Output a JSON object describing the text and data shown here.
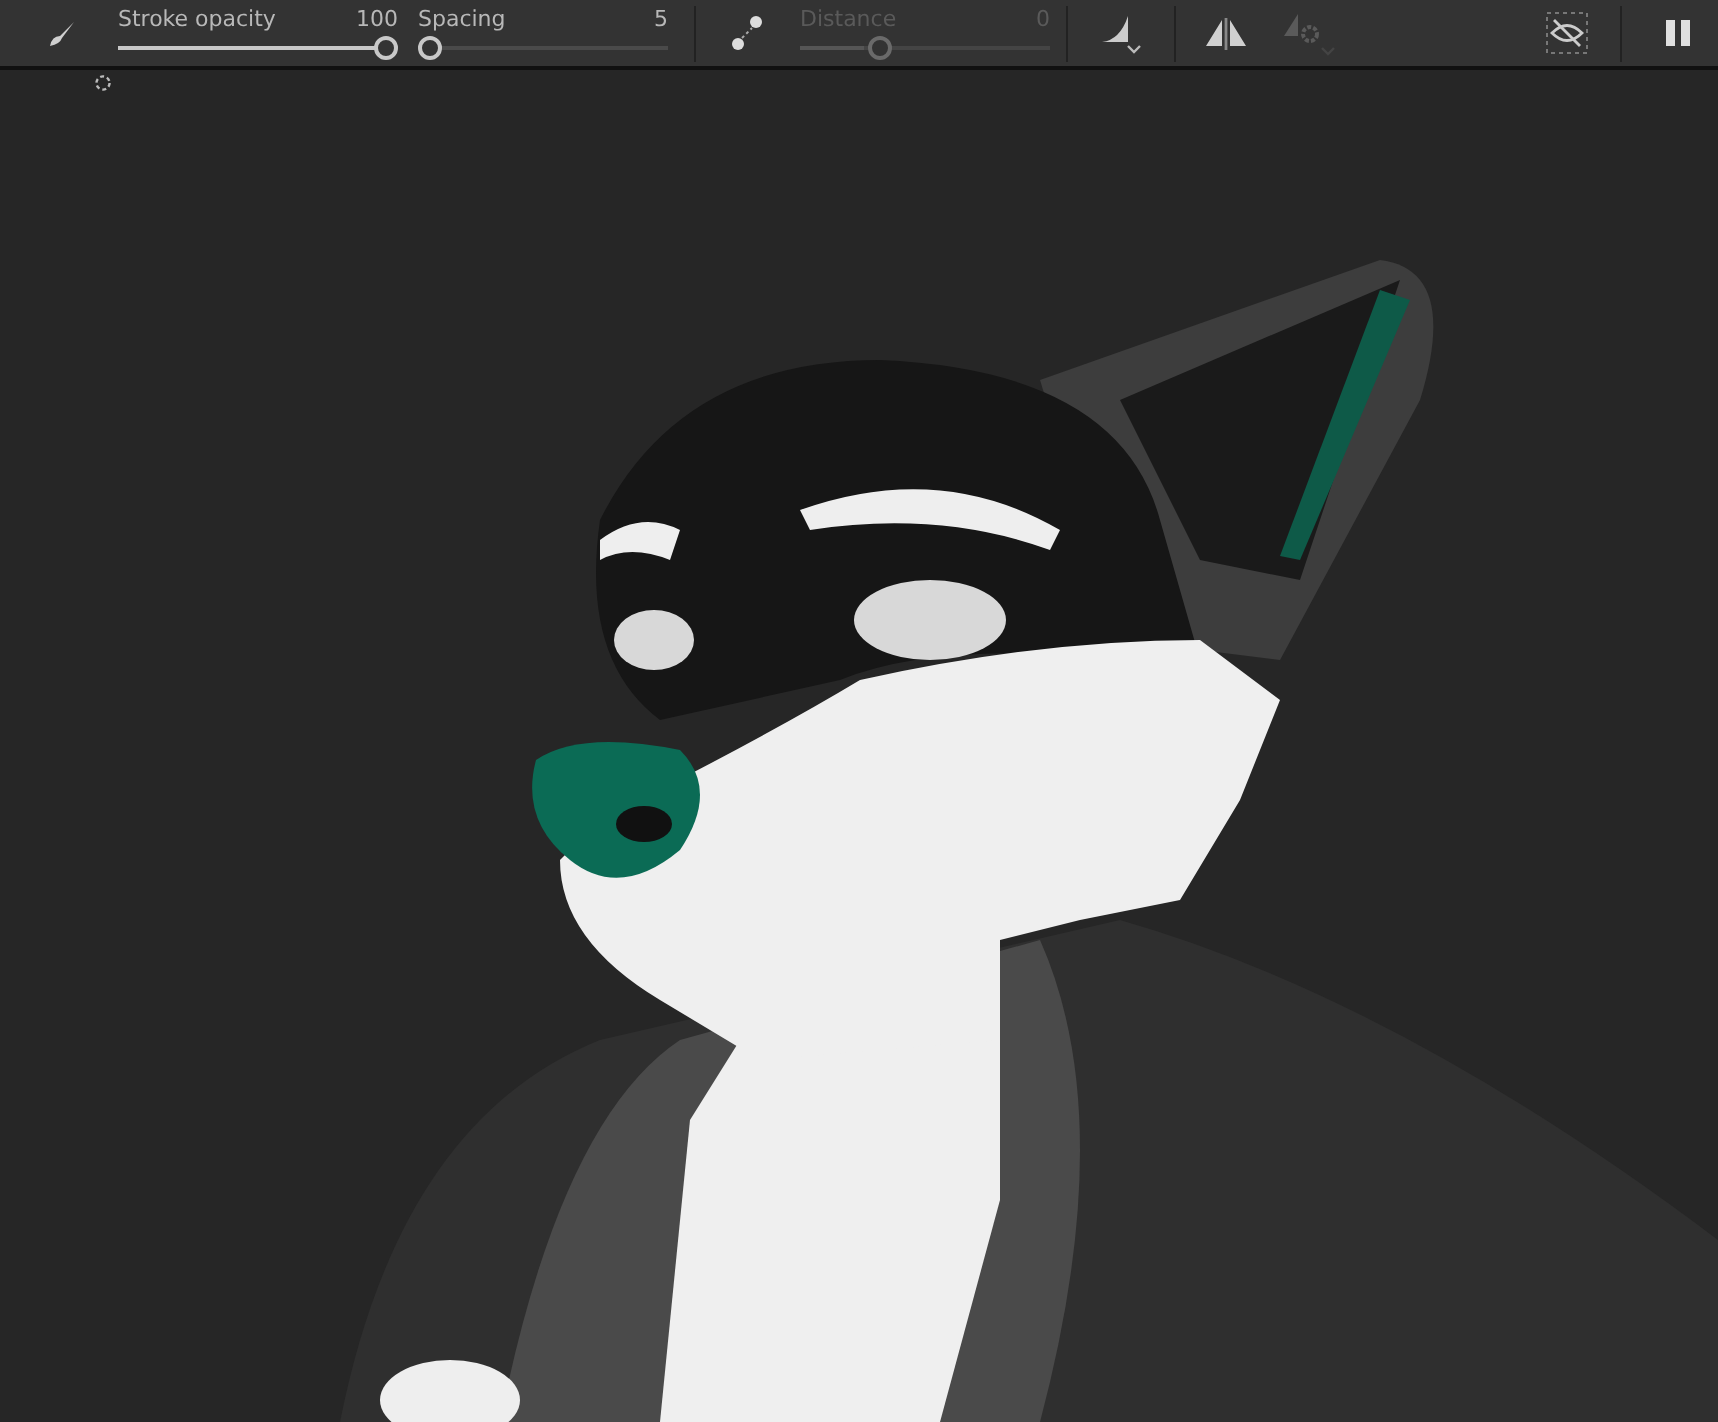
{
  "toolbar": {
    "sliders": [
      {
        "label": "Stroke opacity",
        "reading": "100",
        "level": 1,
        "disabled": false
      },
      {
        "label": "Spacing",
        "reading": "5",
        "level": 0,
        "disabled": false
      },
      {
        "label": "Distance",
        "reading": "0",
        "level": 0.3,
        "disabled": true
      }
    ]
  }
}
